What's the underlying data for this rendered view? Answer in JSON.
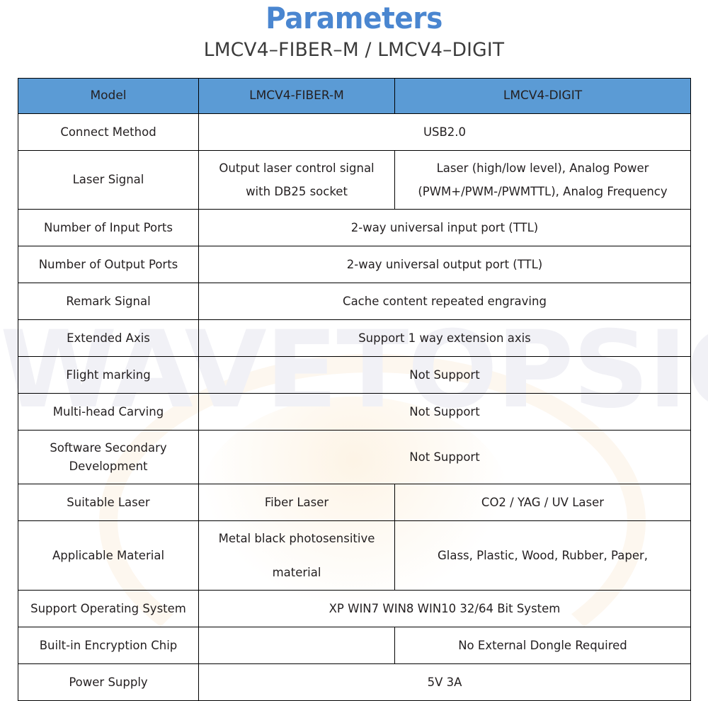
{
  "header": {
    "title": "Parameters",
    "subtitle": "LMCV4–FIBER–M / LMCV4–DIGIT"
  },
  "watermark": {
    "text": "WAVETOPSIGN"
  },
  "colors": {
    "header_blue": "#5B9BD5",
    "title_blue": "#4A86D0",
    "border": "#000000",
    "text": "#231F20",
    "watermark": "#F1F1F6"
  },
  "table": {
    "columns": [
      {
        "label": "Model"
      },
      {
        "label": "LMCV4-FIBER-M"
      },
      {
        "label": "LMCV4-DIGIT"
      }
    ],
    "rows": [
      {
        "name": "Connect Method",
        "merged": true,
        "shared": "USB2.0"
      },
      {
        "name": "Laser Signal",
        "merged": false,
        "fiber_line1": "Output laser control signal",
        "fiber_line2": "with DB25 socket",
        "digit_line1": "Laser (high/low level), Analog Power",
        "digit_line2": "(PWM+/PWM-/PWMTTL), Analog Frequency"
      },
      {
        "name": "Number of Input Ports",
        "merged": true,
        "shared": "2-way universal input port (TTL)"
      },
      {
        "name": "Number of Output Ports",
        "merged": true,
        "shared": "2-way universal output port (TTL)"
      },
      {
        "name": "Remark Signal",
        "merged": true,
        "shared": "Cache content repeated engraving"
      },
      {
        "name": "Extended Axis",
        "merged": true,
        "shared": "Support 1 way extension axis"
      },
      {
        "name": "Flight marking",
        "merged": true,
        "shared": "Not Support"
      },
      {
        "name": "Multi-head Carving",
        "merged": true,
        "shared": "Not Support"
      },
      {
        "name_line1": "Software Secondary",
        "name_line2": "Development",
        "merged": true,
        "shared": "Not Support"
      },
      {
        "name": "Suitable Laser",
        "merged": false,
        "fiber": "Fiber Laser",
        "digit": "CO2 / YAG / UV Laser"
      },
      {
        "name": "Applicable Material",
        "merged": false,
        "fiber_line1": "Metal black photosensitive",
        "fiber_line2": "material",
        "digit": "Glass, Plastic, Wood, Rubber, Paper,"
      },
      {
        "name": "Support Operating System",
        "merged": true,
        "shared": "XP WIN7 WIN8 WIN10 32/64 Bit System"
      },
      {
        "name": "Built-in Encryption Chip",
        "merged": false,
        "fiber": "",
        "digit": "No External Dongle Required"
      },
      {
        "name": "Power Supply",
        "merged": true,
        "shared": "5V 3A"
      }
    ]
  }
}
